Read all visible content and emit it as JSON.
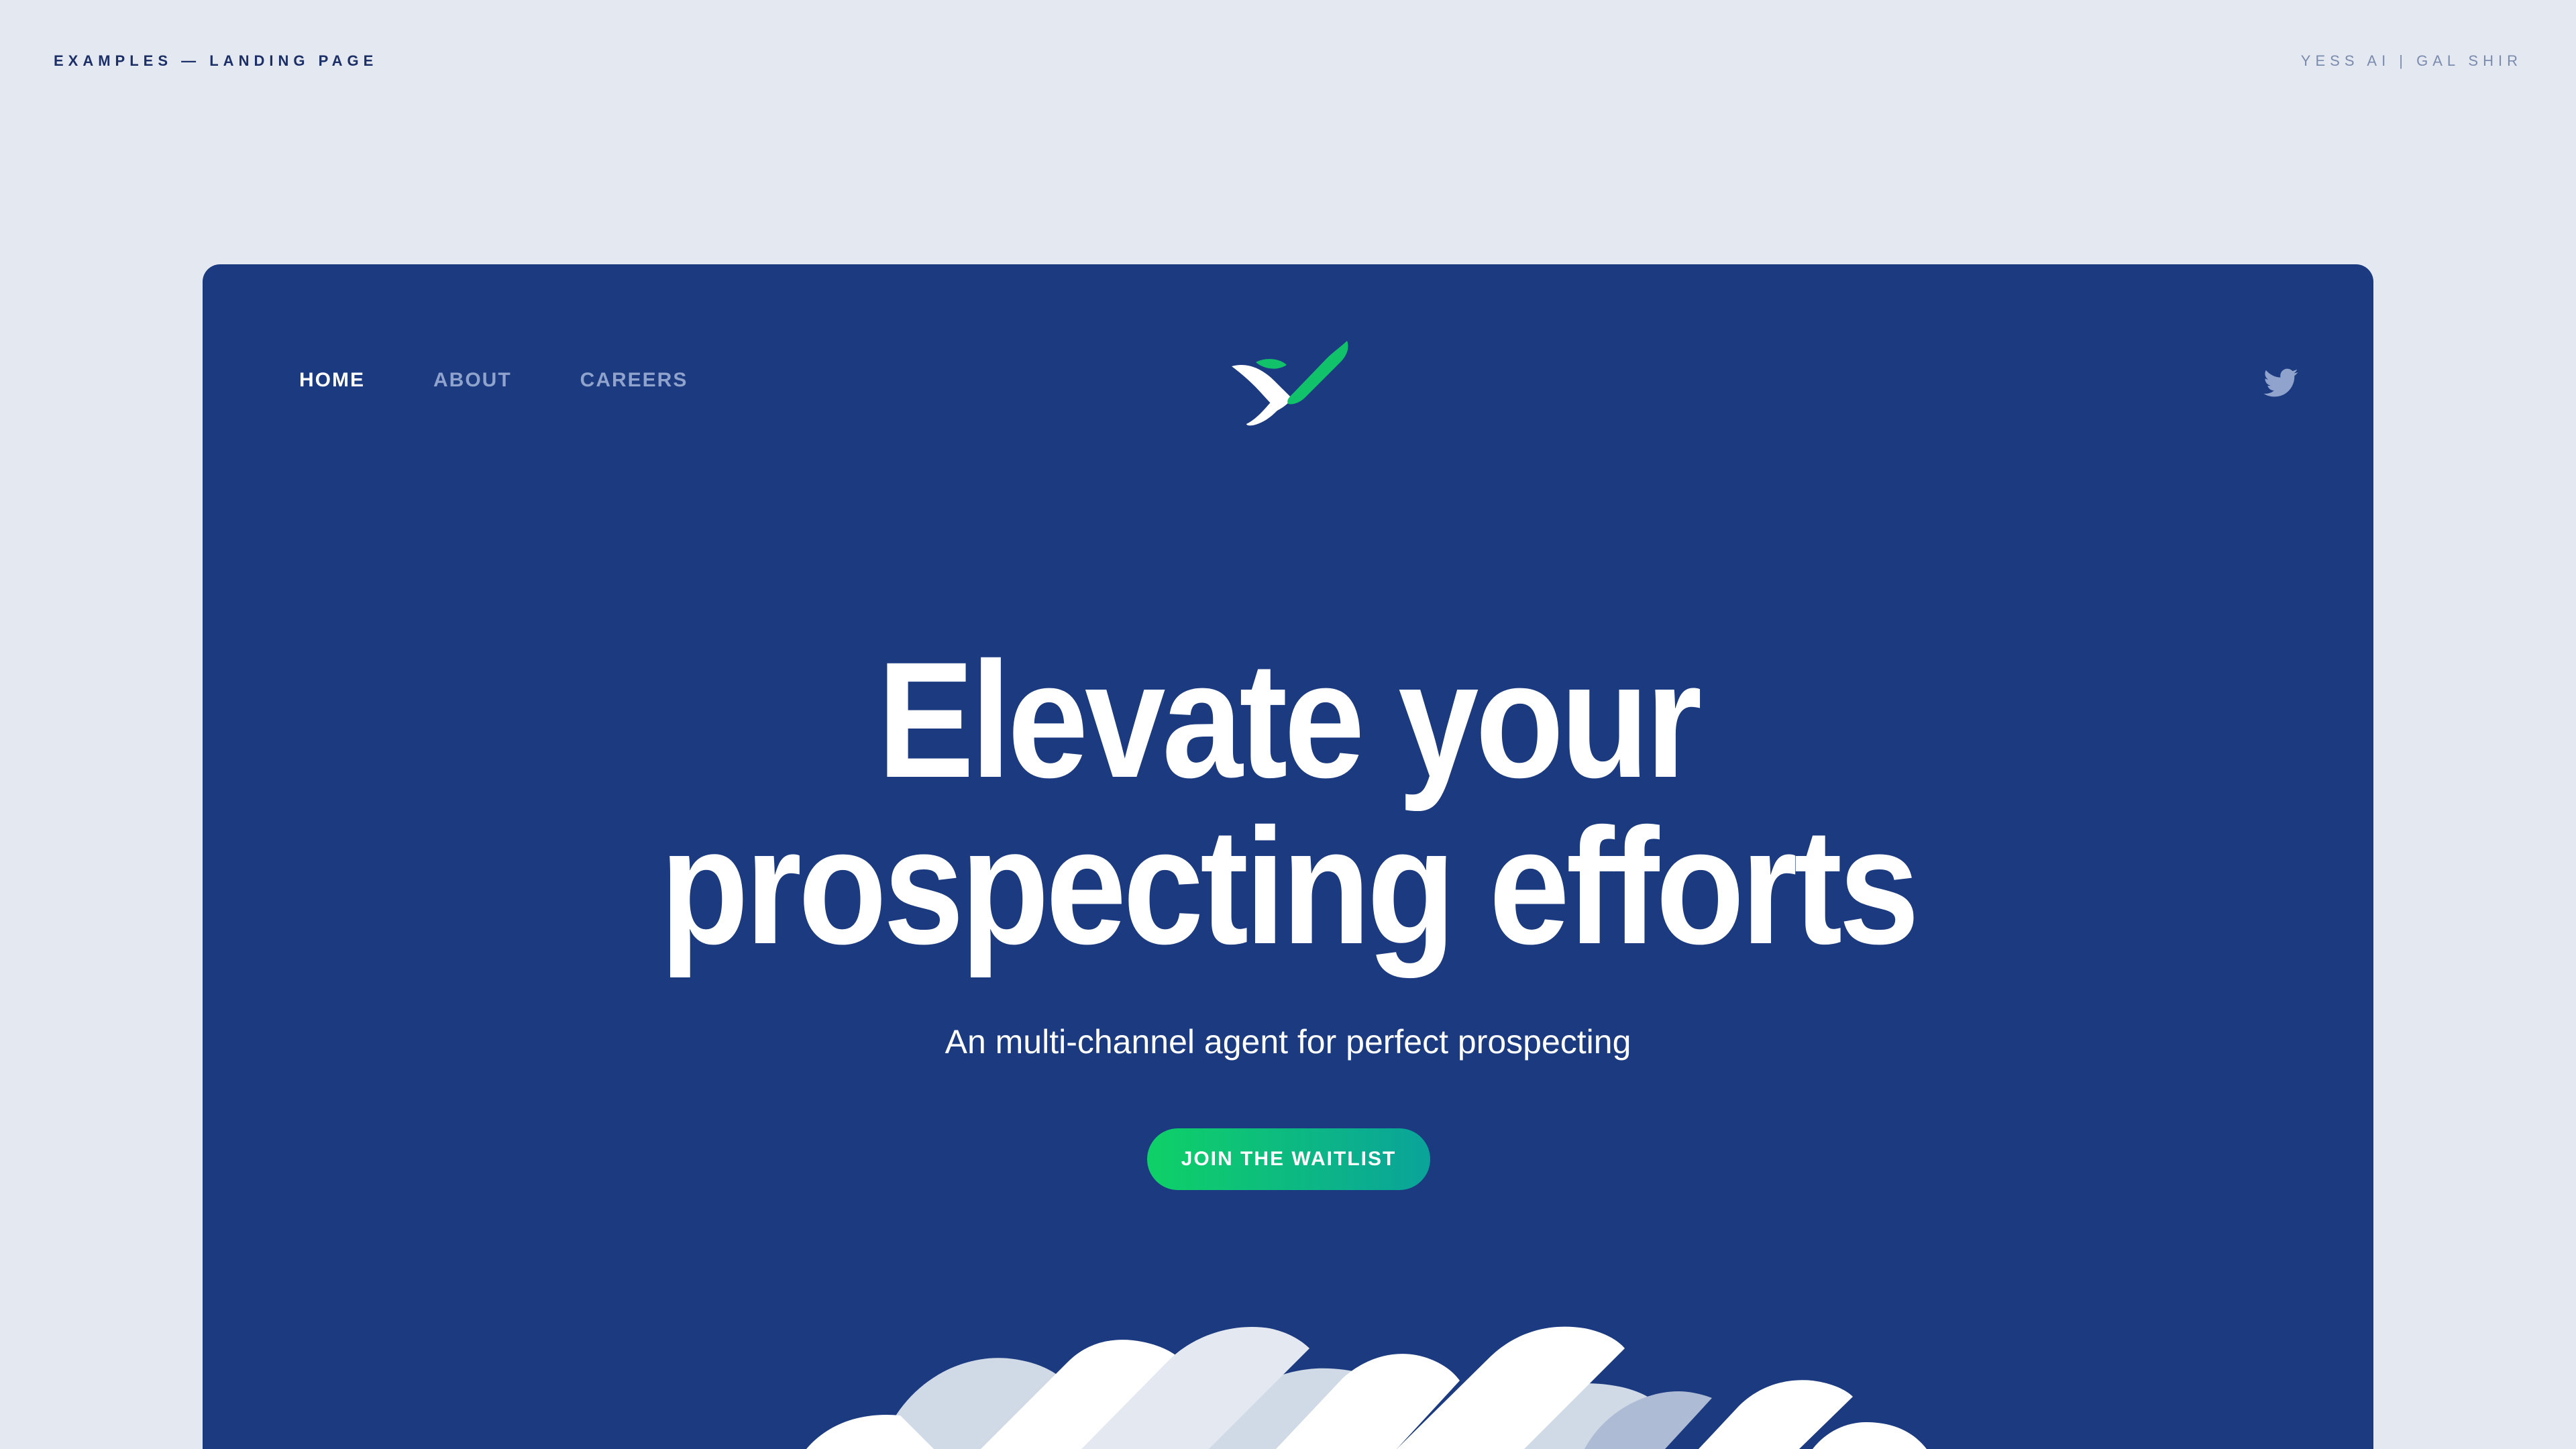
{
  "header": {
    "left_caption": "EXAMPLES — LANDING PAGE",
    "right_caption": "YESS AI | GAL SHIR"
  },
  "nav": {
    "items": [
      {
        "label": "HOME",
        "active": true
      },
      {
        "label": "ABOUT",
        "active": false
      },
      {
        "label": "CAREERS",
        "active": false
      }
    ]
  },
  "logo": {
    "icon": "yess-logo-icon",
    "colors": {
      "white": "#ffffff",
      "green": "#12c26b"
    }
  },
  "social": {
    "icon": "twitter-icon"
  },
  "hero": {
    "title_line1": "Elevate your",
    "title_line2": "prospecting efforts",
    "subtitle": "An multi-channel agent for perfect prospecting",
    "cta_label": "JOIN THE WAITLIST"
  },
  "colors": {
    "page_background": "#e4e9f1",
    "card_background": "#1b3a7f",
    "cta_gradient_start": "#0fd167",
    "cta_gradient_end": "#0aa39a",
    "nav_inactive": "#8fa3cc"
  }
}
